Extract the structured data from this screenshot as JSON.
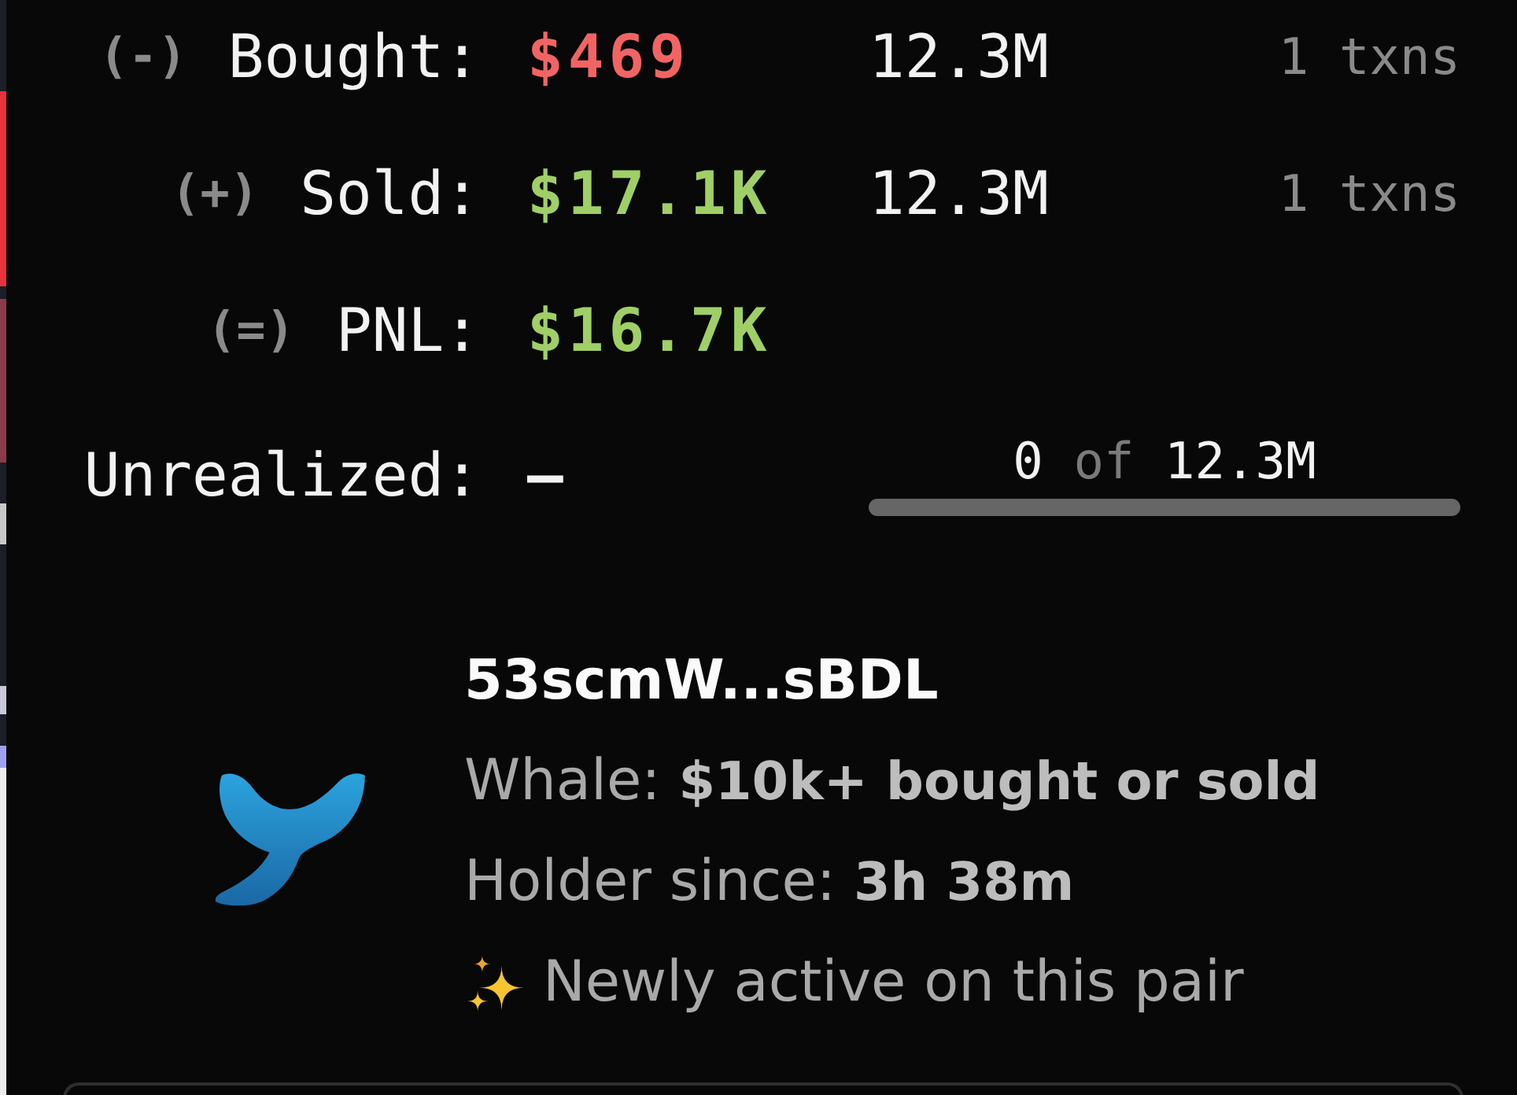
{
  "trades": [
    {
      "sign": "(-)",
      "label": "Bought:",
      "amount": "$469",
      "color": "#f26464",
      "tokens": "12.3M",
      "txns": "1 txns"
    },
    {
      "sign": "(+)",
      "label": "Sold:",
      "amount": "$17.1K",
      "color": "#9fcf66",
      "tokens": "12.3M",
      "txns": "1 txns"
    },
    {
      "sign": "(=)",
      "label": "PNL:",
      "amount": "$16.7K",
      "color": "#9fcf66"
    }
  ],
  "unrealized": {
    "label": "Unrealized:",
    "value": "–",
    "held": "0",
    "separator": "of",
    "total": "12.3M",
    "level": 0
  },
  "wallet": {
    "address": "53scmW...sBDL",
    "details": [
      "Whale: **$10k+ bought or sold**",
      "Holder since: **3h 38m**"
    ],
    "note": "Newly active on this pair"
  }
}
